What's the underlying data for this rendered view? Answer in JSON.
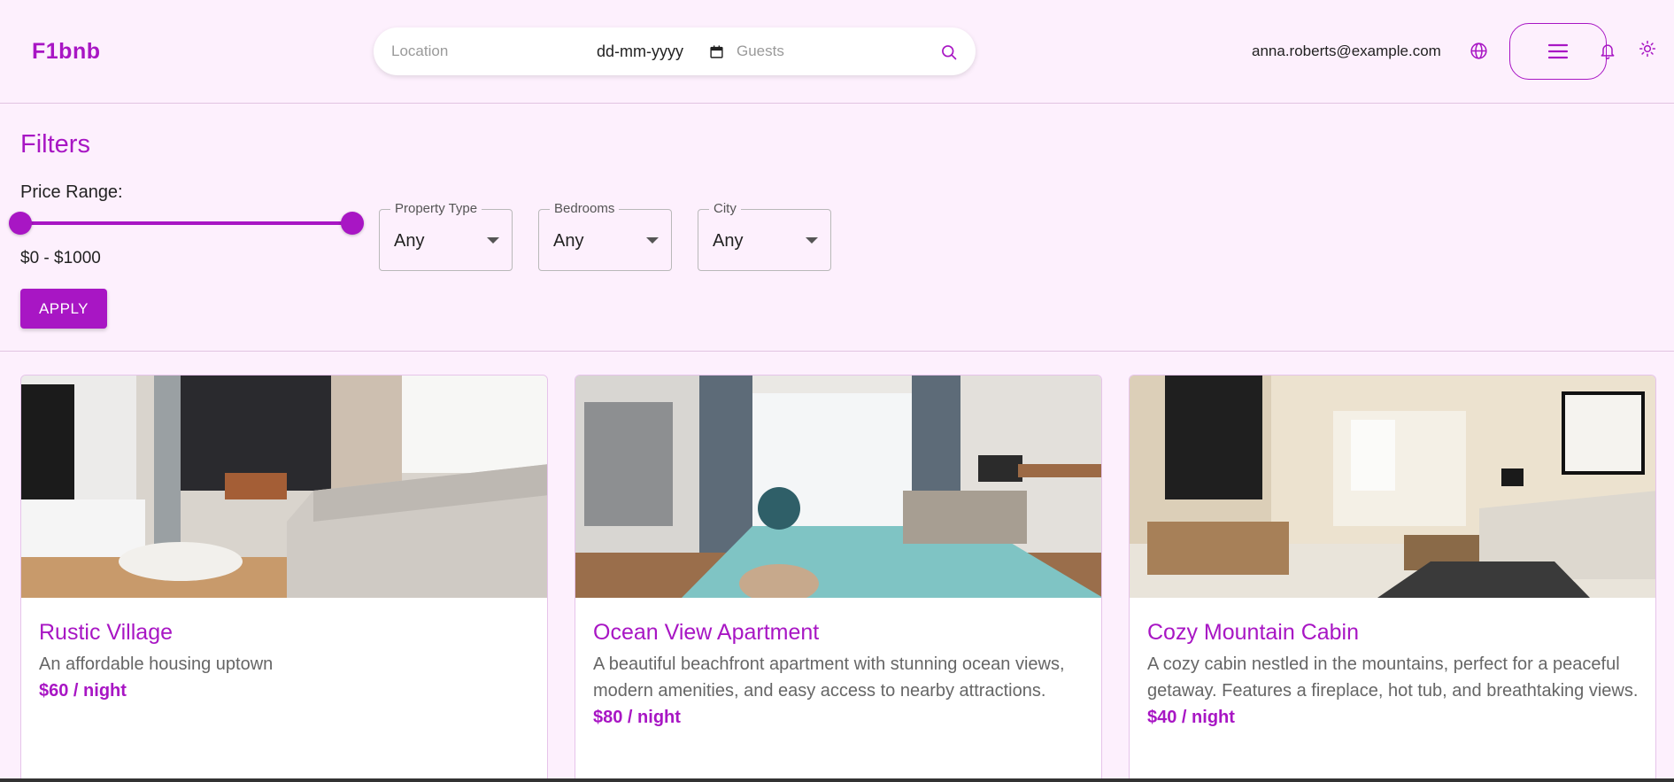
{
  "header": {
    "logo": "F1bnb",
    "search": {
      "location_placeholder": "Location",
      "date_value": "dd-mm-yyyy",
      "guests_placeholder": "Guests"
    },
    "user_email": "anna.roberts@example.com",
    "icons": [
      "globe-icon",
      "menu-icon",
      "bell-icon",
      "sun-icon",
      "search-icon",
      "calendar-icon"
    ]
  },
  "filters": {
    "title": "Filters",
    "price_label": "Price Range:",
    "price_range": {
      "min": 0,
      "max": 1000,
      "display": "$0 - $1000"
    },
    "selects": [
      {
        "label": "Property Type",
        "value": "Any"
      },
      {
        "label": "Bedrooms",
        "value": "Any"
      },
      {
        "label": "City",
        "value": "Any"
      }
    ],
    "apply_label": "APPLY"
  },
  "listings": [
    {
      "title": "Rustic Village",
      "description": "An affordable housing uptown",
      "price": "$60 / night"
    },
    {
      "title": "Ocean View Apartment",
      "description": "A beautiful beachfront apartment with stunning ocean views, modern amenities, and easy access to nearby attractions.",
      "price": "$80 / night"
    },
    {
      "title": "Cozy Mountain Cabin",
      "description": "A cozy cabin nestled in the mountains, perfect for a peaceful getaway. Features a fireplace, hot tub, and breathtaking views.",
      "price": "$40 / night"
    }
  ],
  "colors": {
    "accent": "#a816c4",
    "background": "#fdf0fd",
    "divider": "#e2c4e2"
  }
}
